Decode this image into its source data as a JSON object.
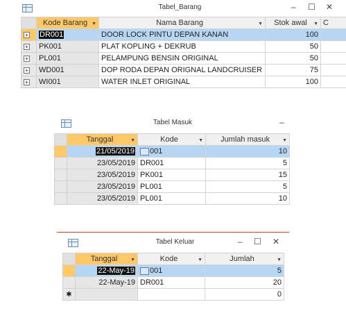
{
  "win1": {
    "title": "Tabel_Barang",
    "controls": {
      "minimize": "–",
      "maximize": "☐",
      "close": "✕"
    },
    "columns": [
      "Kode Barang",
      "Nama Barang",
      "Stok awal",
      "C"
    ],
    "rows": [
      {
        "kode": "DR001",
        "nama": "DOOR LOCK PINTU DEPAN KANAN",
        "stok": "100"
      },
      {
        "kode": "PK001",
        "nama": "PLAT KOPLING + DEKRUB",
        "stok": "50"
      },
      {
        "kode": "PL001",
        "nama": "PELAMPUNG BENSIN ORIGINAL",
        "stok": "50"
      },
      {
        "kode": "WD001",
        "nama": "DOP RODA DEPAN ORIGNAL LANDCRUISER",
        "stok": "75"
      },
      {
        "kode": "WI001",
        "nama": "WATER INLET ORIGINAL",
        "stok": "100"
      }
    ]
  },
  "win2": {
    "title": "Tabel Masuk",
    "controls": {
      "minimize": "–"
    },
    "columns": [
      "Tanggal",
      "Kode",
      "Jumlah masuk"
    ],
    "rows": [
      {
        "tanggal": "21/05/2019",
        "kode": "001",
        "jumlah": "10"
      },
      {
        "tanggal": "23/05/2019",
        "kode": "DR001",
        "jumlah": "5"
      },
      {
        "tanggal": "23/05/2019",
        "kode": "PK001",
        "jumlah": "15"
      },
      {
        "tanggal": "23/05/2019",
        "kode": "PL001",
        "jumlah": "5"
      },
      {
        "tanggal": "23/05/2019",
        "kode": "PL001",
        "jumlah": "10"
      }
    ]
  },
  "win3": {
    "title": "Tabel Keluar",
    "controls": {
      "minimize": "–",
      "maximize": "☐",
      "close": "✕"
    },
    "columns": [
      "Tanggal",
      "Kode",
      "Jumlah"
    ],
    "rows": [
      {
        "tanggal": "22-May-19",
        "kode": "001",
        "jumlah": "5"
      },
      {
        "tanggal": "22-May-19",
        "kode": "DR001",
        "jumlah": "20"
      }
    ],
    "new_row": {
      "marker": "✱",
      "jumlah": "0"
    }
  }
}
